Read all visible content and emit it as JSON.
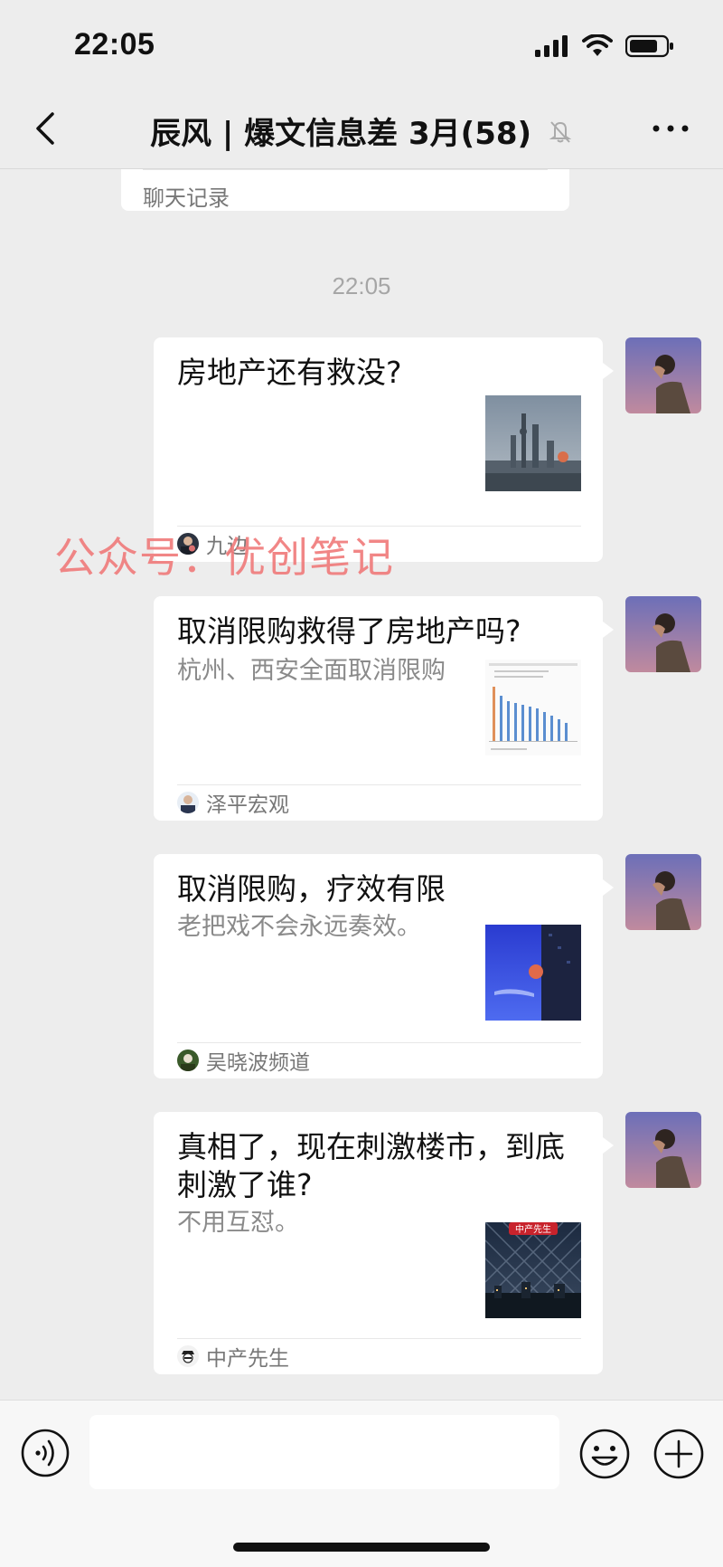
{
  "status_bar": {
    "time": "22:05"
  },
  "nav": {
    "title": "辰风 | 爆文信息差 3月(58)"
  },
  "history_card": {
    "label": "聊天记录"
  },
  "timestamp": "22:05",
  "watermark": "公众号：优创笔记",
  "messages": [
    {
      "title": "房地产还有救没?",
      "desc": "",
      "source": "九边"
    },
    {
      "title": "取消限购救得了房地产吗?",
      "desc": "杭州、西安全面取消限购",
      "source": "泽平宏观"
    },
    {
      "title": "取消限购，疗效有限",
      "desc": "老把戏不会永远奏效。",
      "source": "吴晓波频道"
    },
    {
      "title": "真相了，现在刺激楼市，到底刺激了谁?",
      "desc": "不用互怼。",
      "source": "中产先生",
      "thumb_badge": "中产先生"
    }
  ],
  "colors": {
    "background": "#ededed",
    "card": "#ffffff",
    "watermark": "#f07a7a",
    "timestamp": "#a6a6a6"
  }
}
